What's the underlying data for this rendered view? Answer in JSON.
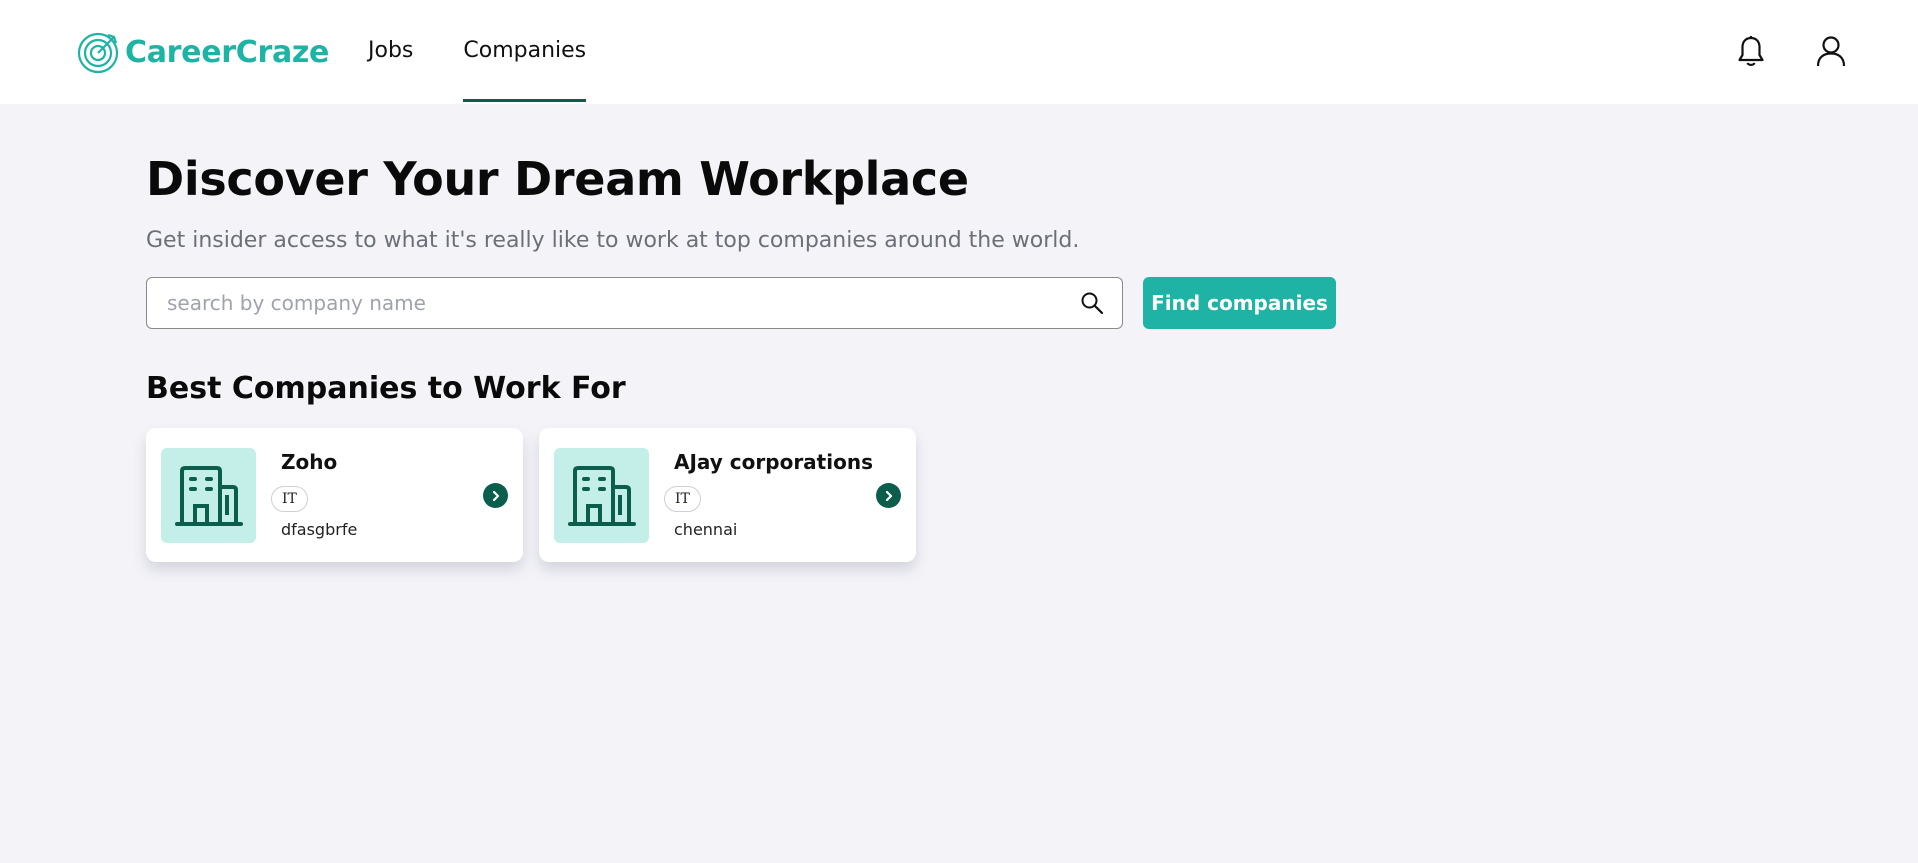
{
  "app": {
    "name": "CareerCraze"
  },
  "header": {
    "logo_icon": "target-arrow-icon",
    "nav": [
      {
        "label": "Jobs",
        "active": false
      },
      {
        "label": "Companies",
        "active": true
      }
    ],
    "icons": [
      "bell-icon",
      "user-icon"
    ]
  },
  "hero": {
    "title": "Discover Your Dream Workplace",
    "subtitle": "Get insider access to what it's really like to work at top companies around the world."
  },
  "search": {
    "placeholder": "search by company name",
    "value": "",
    "button_label": "Find companies"
  },
  "section": {
    "title": "Best Companies to Work For"
  },
  "companies": [
    {
      "name": "Zoho",
      "tag": "IT",
      "location": "dfasgbrfe",
      "icon": "building-icon"
    },
    {
      "name": "AJay corporations",
      "tag": "IT",
      "location": "chennai",
      "icon": "building-icon"
    }
  ],
  "colors": {
    "brand": "#1fb3a5",
    "accent_dark": "#0b5e4b",
    "card_logo_bg": "#c4efe9",
    "page_bg": "#f4f4f8"
  }
}
